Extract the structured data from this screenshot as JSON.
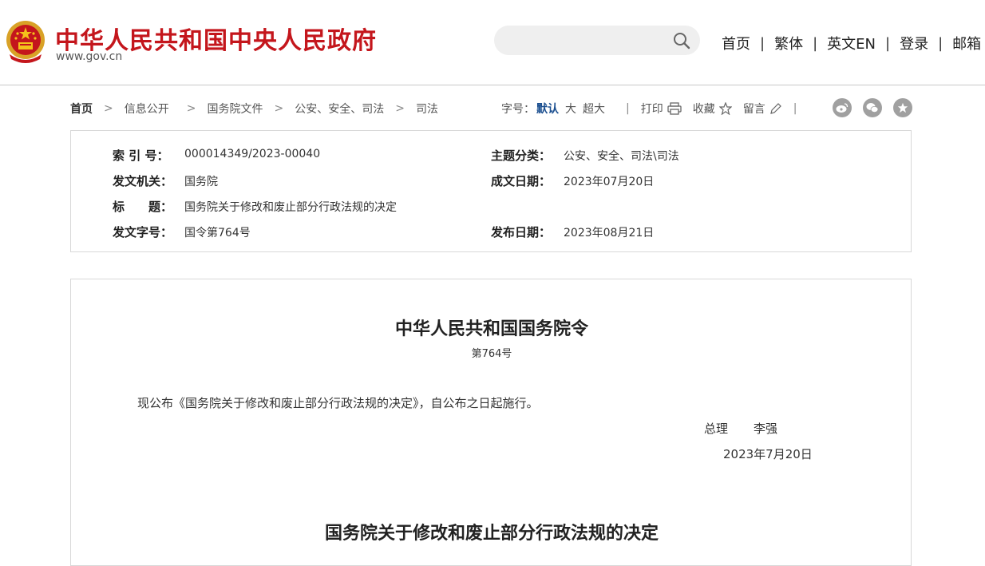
{
  "header": {
    "site_title": "中华人民共和国中央人民政府",
    "site_url": "www.gov.cn",
    "search_placeholder": "",
    "nav": [
      "首页",
      "繁体",
      "英文EN",
      "登录",
      "邮箱"
    ],
    "brand_color": "#c4161c"
  },
  "breadcrumb": {
    "home": "首页",
    "items": [
      "信息公开",
      "国务院文件",
      "公安、安全、司法",
      "司法"
    ]
  },
  "tools": {
    "font_label": "字号：",
    "sizes": [
      "默认",
      "大",
      "超大"
    ],
    "print": "打印",
    "favorite": "收藏",
    "comment": "留言",
    "share_icons": [
      "weibo-icon",
      "wechat-icon",
      "qzone-icon"
    ]
  },
  "meta": {
    "index_label": "索 引 号：",
    "index_value": "000014349/2023-00040",
    "category_label": "主题分类：",
    "category_value": "公安、安全、司法\\司法",
    "issuer_label": "发文机关：",
    "issuer_value": "国务院",
    "date_written_label": "成文日期：",
    "date_written_value": "2023年07月20日",
    "title_label": "标　　题：",
    "title_value": "国务院关于修改和废止部分行政法规的决定",
    "doc_no_label": "发文字号：",
    "doc_no_value": "国令第764号",
    "publish_label": "发布日期：",
    "publish_value": "2023年08月21日"
  },
  "document": {
    "title": "中华人民共和国国务院令",
    "number": "第764号",
    "paragraph": "现公布《国务院关于修改和废止部分行政法规的决定》，自公布之日起施行。",
    "sign_title": "总理",
    "sign_name": "李强",
    "date": "2023年7月20日",
    "subtitle": "国务院关于修改和废止部分行政法规的决定"
  }
}
